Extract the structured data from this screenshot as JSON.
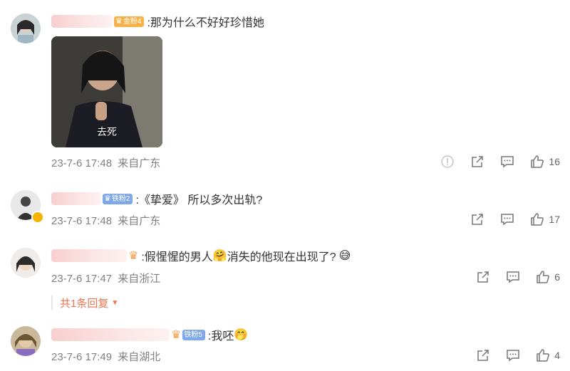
{
  "comments": [
    {
      "badge": "金粉4",
      "text": ":那为什么不好好珍惜她",
      "image_caption": "去死",
      "time": "23-7-6 17:48",
      "source": "来自广东",
      "likes": "16",
      "icons": [
        "report-icon",
        "share-icon",
        "comment-icon",
        "like-icon"
      ]
    },
    {
      "badge": "铁粉2",
      "text": ":《挚爱》 所以多次出轨?",
      "time": "23-7-6 17:48",
      "source": "来自广东",
      "likes": "17",
      "icons": [
        "share-icon",
        "comment-icon",
        "like-icon"
      ]
    },
    {
      "text": ":假惺惺的男人",
      "text2": "消失的他现在出现了?",
      "time": "23-7-6 17:47",
      "source": "来自浙江",
      "likes": "6",
      "reply_link": "共1条回复",
      "icons": [
        "share-icon",
        "comment-icon",
        "like-icon"
      ]
    },
    {
      "badge": "铁粉5",
      "text": ":我呸",
      "time": "23-7-6 17:49",
      "source": "来自湖北",
      "likes": "4",
      "icons": [
        "share-icon",
        "comment-icon",
        "like-icon"
      ]
    }
  ],
  "colors": {
    "reply_link": "#eb7350",
    "gold_badge": "#f6b24a",
    "iron_badge": "#7fa8e6",
    "meta_text": "#808080"
  }
}
